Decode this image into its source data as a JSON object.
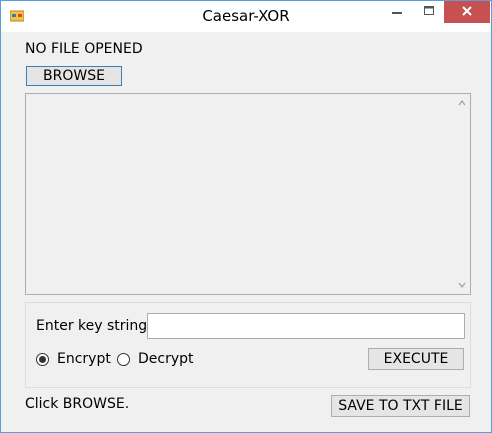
{
  "window": {
    "title": "Caesar-XOR",
    "app_icon": "window-app-icon",
    "controls": {
      "minimize": "minimize-icon",
      "maximize": "maximize-icon",
      "close": "close-icon"
    }
  },
  "main": {
    "file_status": "NO FILE OPENED",
    "browse_label": "BROWSE",
    "file_content": ""
  },
  "options": {
    "key_label": "Enter key string",
    "key_value": "",
    "encrypt_label": "Encrypt",
    "decrypt_label": "Decrypt",
    "selected_mode": "Encrypt",
    "execute_label": "EXECUTE"
  },
  "footer": {
    "status": "Click BROWSE.",
    "save_label": "SAVE TO TXT FILE"
  },
  "colors": {
    "close_button": "#c75050",
    "window_border": "#5a9ed6",
    "focus_border": "#3c7fb1"
  }
}
